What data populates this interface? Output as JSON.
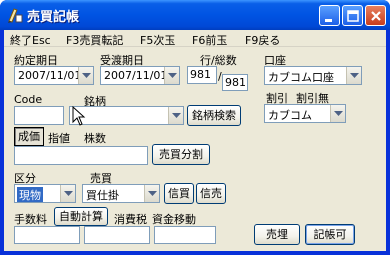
{
  "window": {
    "title": "売買記帳"
  },
  "menu": [
    {
      "label": "終了Esc"
    },
    {
      "label": "F3売買転記"
    },
    {
      "label": "F5次玉"
    },
    {
      "label": "F6前玉"
    },
    {
      "label": "F9戻る"
    }
  ],
  "form": {
    "contract_date": {
      "label": "約定期日",
      "value": "2007/11/01"
    },
    "delivery_date": {
      "label": "受渡期日",
      "value": "2007/11/01"
    },
    "line_total": {
      "label": "行/総数",
      "current": "981",
      "separator": "/",
      "total": "981"
    },
    "account": {
      "label": "口座",
      "value": "カブコム口座"
    },
    "code": {
      "label": "Code",
      "value": ""
    },
    "stock_name": {
      "label": "銘柄",
      "value": ""
    },
    "stock_search_button": "銘柄検索",
    "discount_label": "割引",
    "discount_none_label": "割引無",
    "broker": {
      "value": "カブコム"
    },
    "price_type_market": "成価",
    "price_type_limit": "指値",
    "shares_label": "株数",
    "price_value": "",
    "split_button": "売買分割",
    "category": {
      "label": "区分",
      "value": "現物"
    },
    "trade": {
      "label": "売買",
      "value": "買仕掛"
    },
    "credit_buy_button": "信買",
    "credit_sell_button": "信売",
    "fee_label": "手数料",
    "auto_calc_button": "自動計算",
    "consumption_tax_label": "消費税",
    "fund_transfer_label": "資金移動",
    "transfer_button": "売埋",
    "bookable_button": "記帳可"
  }
}
